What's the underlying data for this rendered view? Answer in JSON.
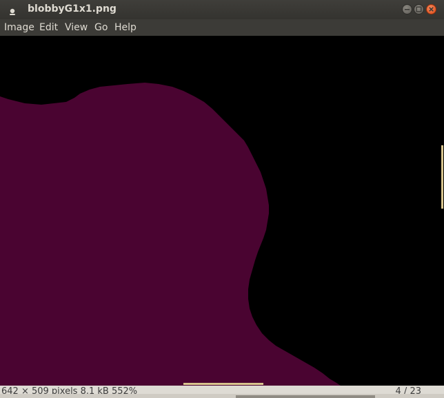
{
  "window": {
    "title": "blobbyG1x1.png",
    "icon": "eye-of-gnome-icon"
  },
  "menubar": {
    "items": [
      {
        "label": "Image"
      },
      {
        "label": "Edit"
      },
      {
        "label": "View"
      },
      {
        "label": "Go"
      },
      {
        "label": "Help"
      }
    ]
  },
  "image": {
    "background_color": "#000000",
    "blob_color": "#4a0431"
  },
  "statusbar": {
    "info": "642 × 509 pixels  8.1 kB   552%",
    "page": "4 / 23"
  },
  "colors": {
    "titlebar": "#3c3b37",
    "menubar": "#3c3b37",
    "accent_scroll": "#d9c58f",
    "close_button": "#dd4814"
  }
}
